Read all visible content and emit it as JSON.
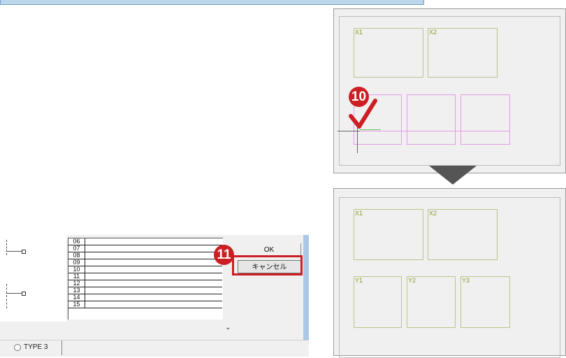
{
  "list": {
    "rows": [
      "06",
      "07",
      "08",
      "09",
      "10",
      "11",
      "12",
      "13",
      "14",
      "15"
    ]
  },
  "dialog": {
    "ok_label": "OK",
    "cancel_label": "キャンセル",
    "radio_label": "TYPE 3"
  },
  "callouts": {
    "step10": "10",
    "step11": "11"
  },
  "before_panel": {
    "labels": {
      "x1": "X1",
      "x2": "X2"
    }
  },
  "after_panel": {
    "labels": {
      "x1": "X1",
      "x2": "X2",
      "y1": "Y1",
      "y2": "Y2",
      "y3": "Y3"
    }
  },
  "colors": {
    "highlight": "#cc1f23",
    "room_outline": "#bcc48a",
    "pink_outline": "#e89ae8",
    "arrow": "#555555"
  },
  "icons": {
    "checkmark": "check-icon",
    "scroll_down": "chevron-down-icon",
    "arrow_down": "triangle-down-icon"
  }
}
